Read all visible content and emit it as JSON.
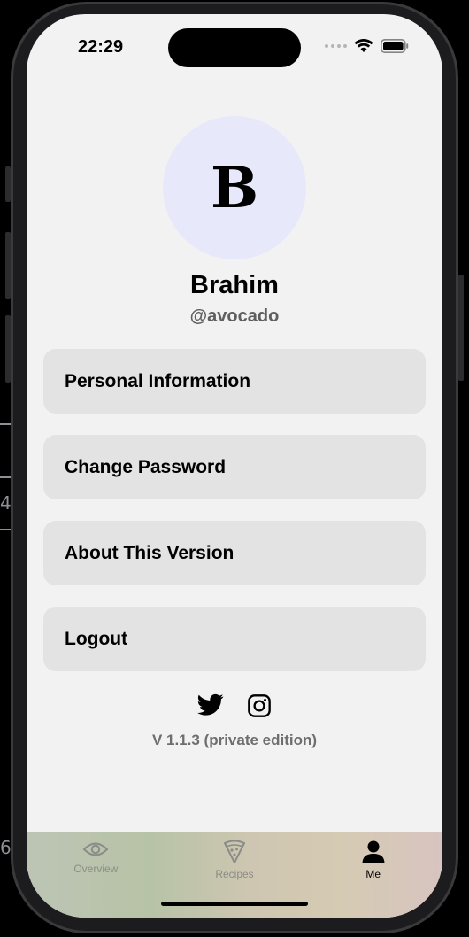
{
  "status_bar": {
    "time": "22:29"
  },
  "profile": {
    "avatar_letter": "B",
    "name": "Brahim",
    "handle": "@avocado"
  },
  "menu": [
    {
      "label": "Personal Information"
    },
    {
      "label": "Change Password"
    },
    {
      "label": "About This Version"
    },
    {
      "label": "Logout"
    }
  ],
  "social": {
    "icons": [
      "twitter-icon",
      "instagram-icon"
    ]
  },
  "version_text": "V 1.1.3 (private edition)",
  "tabs": [
    {
      "label": "Overview",
      "icon": "eye-icon",
      "active": false
    },
    {
      "label": "Recipes",
      "icon": "pizza-icon",
      "active": false
    },
    {
      "label": "Me",
      "icon": "person-icon",
      "active": true
    }
  ],
  "edge_fragments": [
    "4",
    "6"
  ],
  "colors": {
    "background": "#f2f2f2",
    "card": "#e4e3e4",
    "avatar_bg": "#e7e9fb",
    "active_tab": "#000000",
    "inactive_tab": "#8a8c87"
  }
}
